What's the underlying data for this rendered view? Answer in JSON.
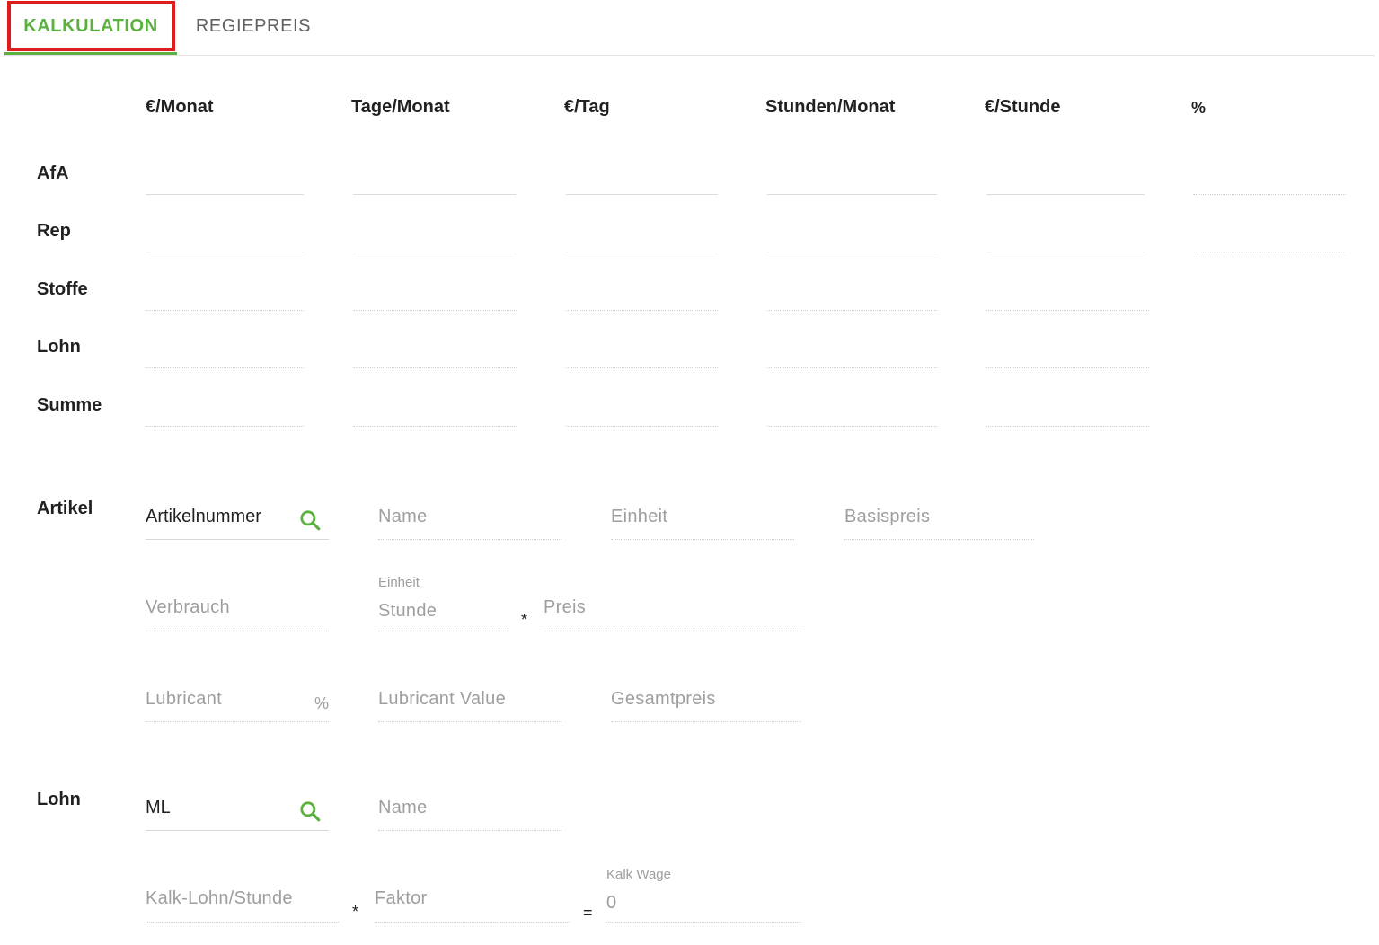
{
  "tabs": [
    {
      "label": "KALKULATION",
      "active": true
    },
    {
      "label": "REGIEPREIS",
      "active": false
    }
  ],
  "colors": {
    "accent": "#5cb040",
    "highlight": "#e01b1b",
    "placeholder": "#9e9e9e"
  },
  "grid": {
    "columns": [
      "€/Monat",
      "Tage/Monat",
      "€/Tag",
      "Stunden/Monat",
      "€/Stunde",
      "%"
    ],
    "rows": [
      "AfA",
      "Rep",
      "Stoffe",
      "Lohn",
      "Summe"
    ]
  },
  "artikel": {
    "section_label": "Artikel",
    "artikelnummer": {
      "value": "Artikelnummer",
      "icon": "search-icon"
    },
    "name_placeholder": "Name",
    "einheit_placeholder": "Einheit",
    "basispreis_placeholder": "Basispreis",
    "verbrauch_placeholder": "Verbrauch",
    "einheit_field": {
      "label": "Einheit",
      "value": "Stunde"
    },
    "multiply_operator": "*",
    "preis_placeholder": "Preis",
    "lubricant_placeholder": "Lubricant",
    "lubricant_suffix": "%",
    "lubricant_value_placeholder": "Lubricant Value",
    "gesamtpreis_placeholder": "Gesamtpreis"
  },
  "lohn": {
    "section_label": "Lohn",
    "code": {
      "value": "ML",
      "icon": "search-icon"
    },
    "name_placeholder": "Name",
    "kalk_lohn_placeholder": "Kalk-Lohn/Stunde",
    "multiply_operator": "*",
    "faktor_placeholder": "Faktor",
    "equals_operator": "=",
    "kalk_wage": {
      "label": "Kalk Wage",
      "value": "0"
    }
  }
}
